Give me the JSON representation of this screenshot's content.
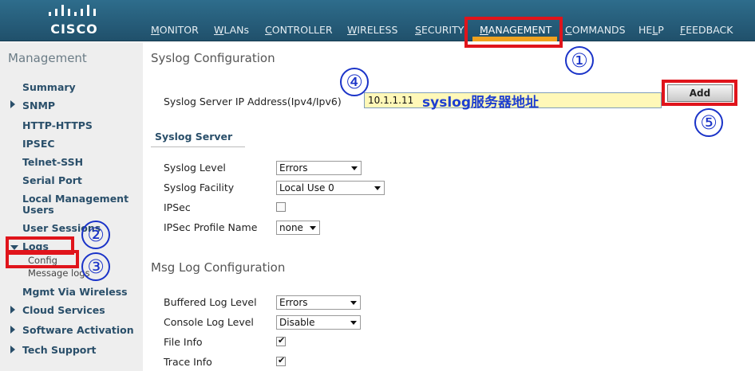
{
  "brand": {
    "logo_text": "CISCO"
  },
  "nav": {
    "monitor": {
      "first": "M",
      "rest": "ONITOR"
    },
    "wlans": {
      "first": "W",
      "rest": "LANs"
    },
    "controller": {
      "first": "C",
      "rest": "ONTROLLER"
    },
    "wireless": {
      "first": "W",
      "rest": "IRELESS"
    },
    "security": {
      "first": "S",
      "rest": "ECURITY"
    },
    "management": {
      "first": "M",
      "rest": "ANAGEMENT"
    },
    "commands": {
      "first": "C",
      "rest": "OMMANDS"
    },
    "help": {
      "first": "HE",
      "mid": "L",
      "rest": "P"
    },
    "feedback": {
      "first": "F",
      "rest": "EEDBACK"
    },
    "active_color": "#f0a21f"
  },
  "sidebar": {
    "title": "Management",
    "items": {
      "summary": "Summary",
      "snmp": "SNMP",
      "http": "HTTP-HTTPS",
      "ipsec": "IPSEC",
      "telnet": "Telnet-SSH",
      "serial": "Serial Port",
      "local_mgmt": "Local Management Users",
      "user_sessions": "User Sessions",
      "logs": "Logs",
      "config": "Config",
      "message_logs": "Message logs",
      "mgmt_wireless": "Mgmt Via Wireless",
      "cloud": "Cloud Services",
      "software": "Software Activation",
      "tech": "Tech Support"
    }
  },
  "main": {
    "syslog_title": "Syslog Configuration",
    "ip_label": "Syslog Server IP Address(Ipv4/Ipv6)",
    "ip_value": "10.1.1.11",
    "ip_hint": "syslog服务器地址",
    "add_label": "Add",
    "syslog_server_heading": "Syslog Server",
    "syslog_level_label": "Syslog Level",
    "syslog_level_value": "Errors",
    "syslog_facility_label": "Syslog Facility",
    "syslog_facility_value": "Local Use 0",
    "ipsec_label": "IPSec",
    "ipsec_checked": false,
    "ipsec_profile_label": "IPSec Profile Name",
    "ipsec_profile_value": "none",
    "msg_log_title": "Msg Log Configuration",
    "buffered_label": "Buffered Log Level",
    "buffered_value": "Errors",
    "console_label": "Console Log Level",
    "console_value": "Disable",
    "file_info_label": "File Info",
    "file_info_checked": true,
    "trace_info_label": "Trace Info",
    "trace_info_checked": true
  },
  "annotations": {
    "step1": "①",
    "step2": "②",
    "step3": "③",
    "step4": "④",
    "step5": "⑤",
    "highlight_color": "#e0141b",
    "circle_color": "#1a33c8"
  }
}
